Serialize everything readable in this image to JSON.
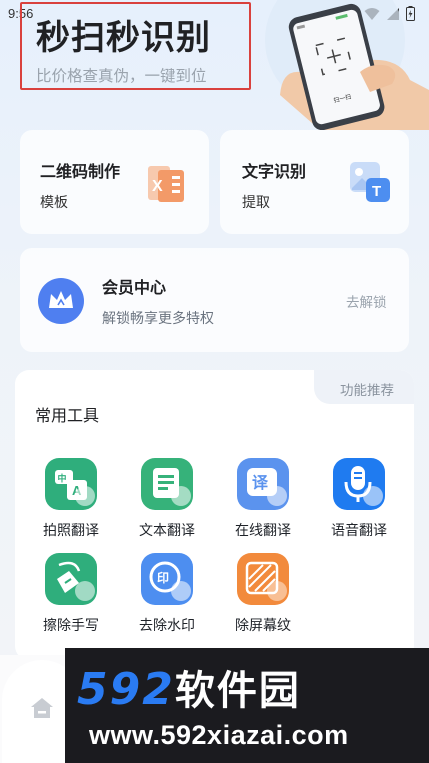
{
  "status_bar": {
    "time": "9:56"
  },
  "hero": {
    "title": "秒扫秒识别",
    "subtitle": "比价格查真伪，一键到位",
    "phone_button": "扫一扫"
  },
  "cards": {
    "qr": {
      "title": "二维码制作",
      "subtitle": "模板"
    },
    "ocr": {
      "title": "文字识别",
      "subtitle": "提取"
    },
    "vip": {
      "title": "会员中心",
      "subtitle": "解锁畅享更多特权",
      "action": "去解锁"
    }
  },
  "tools": {
    "tab_label": "功能推荐",
    "title": "常用工具",
    "items": [
      {
        "label": "拍照翻译",
        "icon": "photo-translate-icon",
        "color": "#2fae7c"
      },
      {
        "label": "文本翻译",
        "icon": "text-translate-icon",
        "color": "#36b27a"
      },
      {
        "label": "在线翻译",
        "icon": "online-translate-icon",
        "color": "#5b93ee"
      },
      {
        "label": "语音翻译",
        "icon": "voice-translate-icon",
        "color": "#1f7bf0"
      },
      {
        "label": "擦除手写",
        "icon": "erase-handwriting-icon",
        "color": "#2fae7c"
      },
      {
        "label": "去除水印",
        "icon": "remove-watermark-icon",
        "color": "#4d8ef0"
      },
      {
        "label": "除屏幕纹",
        "icon": "remove-moire-icon",
        "color": "#f28a3c"
      }
    ]
  },
  "watermark": {
    "brand_number": "592",
    "brand_text": "软件园",
    "url": "www.592xiazai.com"
  },
  "colors": {
    "accent_blue": "#2a7bf2",
    "highlight_red": "#d9413d"
  }
}
